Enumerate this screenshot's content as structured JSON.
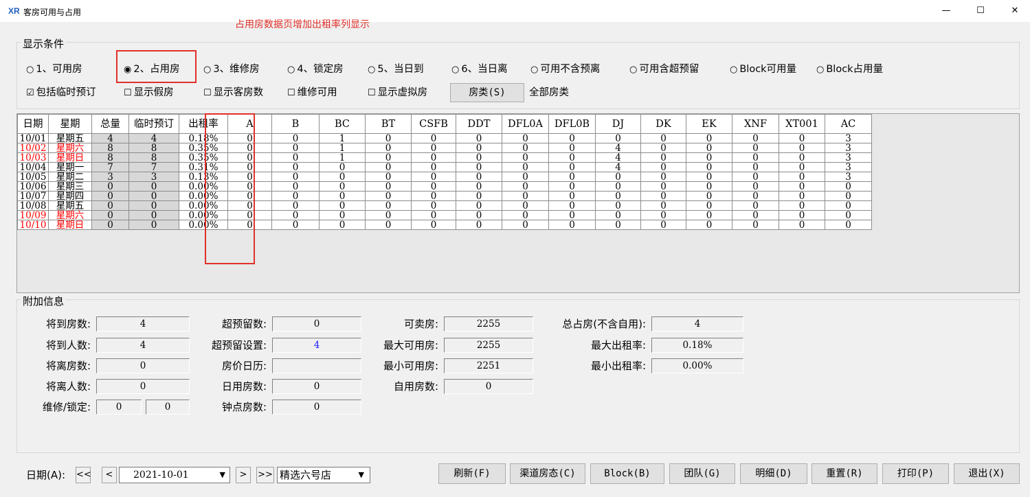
{
  "window": {
    "icon_text": "XR",
    "title": "客房可用与占用",
    "annotation": "占用房数据页增加出租率列显示",
    "minimize": "—",
    "maximize": "☐",
    "close": "✕"
  },
  "conditions": {
    "group_title": "显示条件",
    "radios": [
      {
        "label": "1、可用房",
        "checked": false
      },
      {
        "label": "2、占用房",
        "checked": true
      },
      {
        "label": "3、维修房",
        "checked": false
      },
      {
        "label": "4、锁定房",
        "checked": false
      },
      {
        "label": "5、当日到",
        "checked": false
      },
      {
        "label": "6、当日离",
        "checked": false
      },
      {
        "label": "可用不含预离",
        "checked": false
      },
      {
        "label": "可用含超预留",
        "checked": false
      },
      {
        "label": "Block可用量",
        "checked": false
      },
      {
        "label": "Block占用量",
        "checked": false
      }
    ],
    "checkboxes": [
      {
        "label": "包括临时预订",
        "checked": true
      },
      {
        "label": "显示假房",
        "checked": false
      },
      {
        "label": "显示客房数",
        "checked": false
      },
      {
        "label": "维修可用",
        "checked": false
      },
      {
        "label": "显示虚拟房",
        "checked": false
      }
    ],
    "room_type_button": "房类(S)",
    "room_type_value": "全部房类"
  },
  "grid": {
    "columns": [
      "日期",
      "星期",
      "总量",
      "临时预订",
      "出租率",
      "A",
      "B",
      "BC",
      "BT",
      "CSFB",
      "DDT",
      "DFL0A",
      "DFL0B",
      "DJ",
      "DK",
      "EK",
      "XNF",
      "XT001",
      "AC"
    ],
    "rows": [
      {
        "weekend": false,
        "cells": [
          "10/01",
          "星期五",
          "4",
          "4",
          "0.18%",
          "0",
          "0",
          "1",
          "0",
          "0",
          "0",
          "0",
          "0",
          "0",
          "0",
          "0",
          "0",
          "0",
          "3"
        ]
      },
      {
        "weekend": true,
        "cells": [
          "10/02",
          "星期六",
          "8",
          "8",
          "0.35%",
          "0",
          "0",
          "1",
          "0",
          "0",
          "0",
          "0",
          "0",
          "4",
          "0",
          "0",
          "0",
          "0",
          "3"
        ]
      },
      {
        "weekend": true,
        "cells": [
          "10/03",
          "星期日",
          "8",
          "8",
          "0.35%",
          "0",
          "0",
          "1",
          "0",
          "0",
          "0",
          "0",
          "0",
          "4",
          "0",
          "0",
          "0",
          "0",
          "3"
        ]
      },
      {
        "weekend": false,
        "cells": [
          "10/04",
          "星期一",
          "7",
          "7",
          "0.31%",
          "0",
          "0",
          "0",
          "0",
          "0",
          "0",
          "0",
          "0",
          "4",
          "0",
          "0",
          "0",
          "0",
          "3"
        ]
      },
      {
        "weekend": false,
        "cells": [
          "10/05",
          "星期二",
          "3",
          "3",
          "0.13%",
          "0",
          "0",
          "0",
          "0",
          "0",
          "0",
          "0",
          "0",
          "0",
          "0",
          "0",
          "0",
          "0",
          "3"
        ]
      },
      {
        "weekend": false,
        "cells": [
          "10/06",
          "星期三",
          "0",
          "0",
          "0.00%",
          "0",
          "0",
          "0",
          "0",
          "0",
          "0",
          "0",
          "0",
          "0",
          "0",
          "0",
          "0",
          "0",
          "0"
        ]
      },
      {
        "weekend": false,
        "cells": [
          "10/07",
          "星期四",
          "0",
          "0",
          "0.00%",
          "0",
          "0",
          "0",
          "0",
          "0",
          "0",
          "0",
          "0",
          "0",
          "0",
          "0",
          "0",
          "0",
          "0"
        ]
      },
      {
        "weekend": false,
        "cells": [
          "10/08",
          "星期五",
          "0",
          "0",
          "0.00%",
          "0",
          "0",
          "0",
          "0",
          "0",
          "0",
          "0",
          "0",
          "0",
          "0",
          "0",
          "0",
          "0",
          "0"
        ]
      },
      {
        "weekend": true,
        "cells": [
          "10/09",
          "星期六",
          "0",
          "0",
          "0.00%",
          "0",
          "0",
          "0",
          "0",
          "0",
          "0",
          "0",
          "0",
          "0",
          "0",
          "0",
          "0",
          "0",
          "0"
        ]
      },
      {
        "weekend": true,
        "cells": [
          "10/10",
          "星期日",
          "0",
          "0",
          "0.00%",
          "0",
          "0",
          "0",
          "0",
          "0",
          "0",
          "0",
          "0",
          "0",
          "0",
          "0",
          "0",
          "0",
          "0"
        ]
      }
    ]
  },
  "info": {
    "group_title": "附加信息",
    "arrive_rooms": {
      "label": "将到房数:",
      "value": "4"
    },
    "arrive_people": {
      "label": "将到人数:",
      "value": "4"
    },
    "depart_rooms": {
      "label": "将离房数:",
      "value": "0"
    },
    "depart_people": {
      "label": "将离人数:",
      "value": "0"
    },
    "repair_lock": {
      "label": "维修/锁定:",
      "value1": "0",
      "value2": "0"
    },
    "overbook_count": {
      "label": "超预留数:",
      "value": "0"
    },
    "overbook_setting": {
      "label": "超预留设置:",
      "value": "4"
    },
    "rate_calendar": {
      "label": "房价日历:",
      "value": ""
    },
    "dayuse_rooms": {
      "label": "日用房数:",
      "value": "0"
    },
    "hourly_rooms": {
      "label": "钟点房数:",
      "value": "0"
    },
    "sellable": {
      "label": "可卖房:",
      "value": "2255"
    },
    "max_available": {
      "label": "最大可用房:",
      "value": "2255"
    },
    "min_available": {
      "label": "最小可用房:",
      "value": "2251"
    },
    "selfuse_rooms": {
      "label": "自用房数:",
      "value": "0"
    },
    "total_occupied": {
      "label": "总占房(不含自用):",
      "value": "4"
    },
    "max_occupancy": {
      "label": "最大出租率:",
      "value": "0.18%"
    },
    "min_occupancy": {
      "label": "最小出租率:",
      "value": "0.00%"
    }
  },
  "footer": {
    "date_label": "日期(A):",
    "first": "<<",
    "prev": "<",
    "date_value": "2021-10-01",
    "next": ">",
    "last": ">>",
    "store": "精选六号店",
    "dropdown_arrow": "▼",
    "buttons": [
      "刷新(F)",
      "渠道房态(C)",
      "Block(B)",
      "团队(G)",
      "明细(D)",
      "重置(R)",
      "打印(P)",
      "退出(X)"
    ]
  },
  "colors": {
    "annotation_red": "#e0302a",
    "weekend_red": "#ff0000",
    "overbook_blue": "#1a1aff"
  }
}
